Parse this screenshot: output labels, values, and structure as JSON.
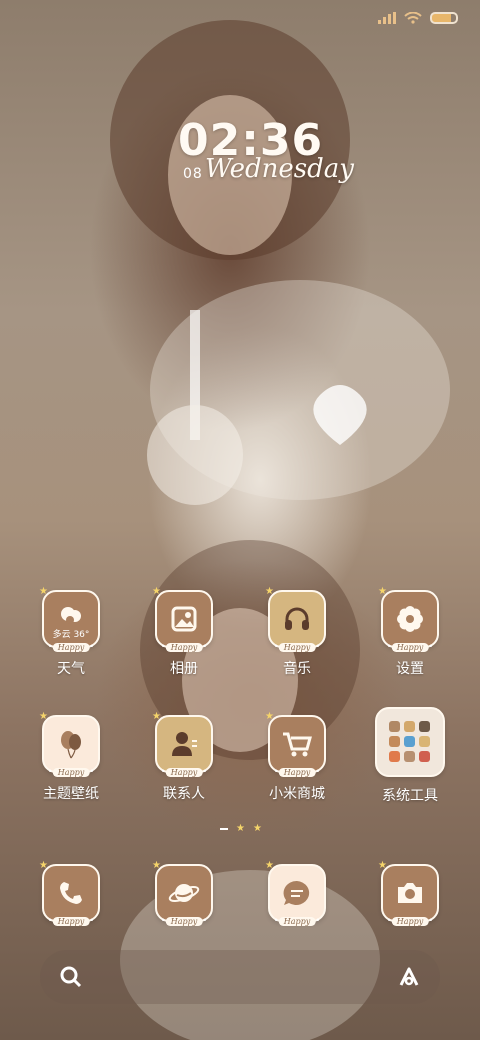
{
  "status_bar": {
    "icons": [
      "signal-icon",
      "wifi-icon",
      "battery-icon"
    ]
  },
  "lock_widget": {
    "time": "02:36",
    "date": "08",
    "weekday": "Wednesday"
  },
  "apps": [
    {
      "label": "天气",
      "badge": "Happy",
      "icon": "weather-cloud-icon",
      "detail": "多云 36°",
      "style": "dark"
    },
    {
      "label": "相册",
      "badge": "Happy",
      "icon": "gallery-icon",
      "style": "dark"
    },
    {
      "label": "音乐",
      "badge": "Happy",
      "icon": "headphones-icon",
      "style": "gold"
    },
    {
      "label": "设置",
      "badge": "Happy",
      "icon": "flower-gear-icon",
      "style": "dark"
    },
    {
      "label": "主题壁纸",
      "badge": "Happy",
      "icon": "balloon-icon",
      "style": "light"
    },
    {
      "label": "联系人",
      "badge": "Happy",
      "icon": "contact-person-icon",
      "style": "gold"
    },
    {
      "label": "小米商城",
      "badge": "Happy",
      "icon": "shopping-cart-icon",
      "style": "dark"
    },
    {
      "label": "系统工具",
      "icon": "folder-grid-icon",
      "style": "pale"
    }
  ],
  "dock_apps": [
    {
      "badge": "Happy",
      "icon": "phone-icon",
      "style": "dark"
    },
    {
      "badge": "Happy",
      "icon": "browser-planet-icon",
      "style": "dark"
    },
    {
      "badge": "Happy",
      "icon": "message-bubble-icon",
      "style": "light"
    },
    {
      "badge": "Happy",
      "icon": "camera-icon",
      "style": "dark"
    }
  ],
  "dock_bar": {
    "left_icon": "search-icon",
    "right_icon": "assistant-a-icon"
  },
  "colors": {
    "icon_dark": "#a97f5f",
    "icon_gold": "#d5b680",
    "icon_light": "#fbeadb",
    "accent_star": "#f5d46a"
  }
}
